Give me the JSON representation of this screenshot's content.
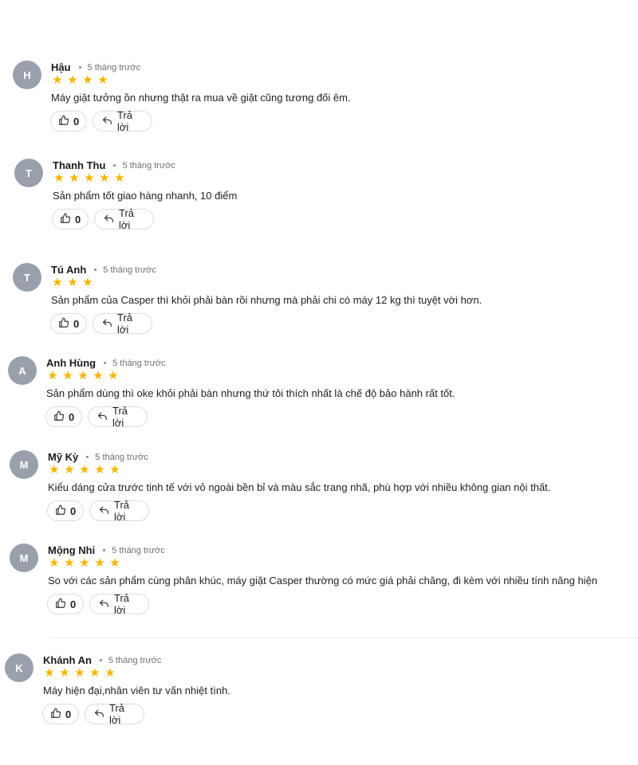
{
  "reviews": [
    {
      "initial": "H",
      "name": "Hậu",
      "time": "5 tháng trước",
      "rating": 4,
      "text": "Máy giặt tưởng ồn nhưng thật ra mua về giặt cũng tương đối êm.",
      "likes": "0",
      "reply_label": "Trả lời"
    },
    {
      "initial": "T",
      "name": "Thanh Thu",
      "time": "5 tháng trước",
      "rating": 5,
      "text": "Sản phẩm tốt giao hàng nhanh, 10 điểm",
      "likes": "0",
      "reply_label": "Trả lời"
    },
    {
      "initial": "T",
      "name": "Tú Anh",
      "time": "5 tháng trước",
      "rating": 3,
      "text": "Sản phẩm của Casper thì khỏi phải bàn rồi nhưng mà phải chi có máy 12 kg thì tuyệt vời hơn.",
      "likes": "0",
      "reply_label": "Trả lời"
    },
    {
      "initial": "A",
      "name": "Anh Hùng",
      "time": "5 tháng trước",
      "rating": 5,
      "text": "Sản phẩm dùng thì oke khỏi phải bàn nhưng thứ tôi thích nhất là chế độ bảo hành rất tốt.",
      "likes": "0",
      "reply_label": "Trả lời"
    },
    {
      "initial": "M",
      "name": "Mỹ Kỳ",
      "time": "5 tháng trước",
      "rating": 5,
      "text": "Kiểu dáng cửa trước tinh tế với vỏ ngoài bền bỉ và màu sắc trang nhã, phù hợp với nhiều không gian nội thất.",
      "likes": "0",
      "reply_label": "Trả lời"
    },
    {
      "initial": "M",
      "name": "Mộng Nhi",
      "time": "5 tháng trước",
      "rating": 5,
      "text": "So với các sản phẩm cùng phân khúc, máy giặt Casper thường có mức giá phải chăng, đi kèm với nhiều tính năng hiện",
      "likes": "0",
      "reply_label": "Trả lời"
    },
    {
      "initial": "K",
      "name": "Khánh An",
      "time": "5 tháng trước",
      "rating": 5,
      "text": "Máy hiện đại,nhân viên tư vấn nhiệt tình.",
      "likes": "0",
      "reply_label": "Trả lời"
    }
  ],
  "colors": {
    "star": "#f7b500",
    "avatar_bg": "#9aa0ab"
  },
  "icons": {
    "like": "thumbs-up-icon",
    "reply": "reply-arrow-icon",
    "rating": "star-icon"
  }
}
